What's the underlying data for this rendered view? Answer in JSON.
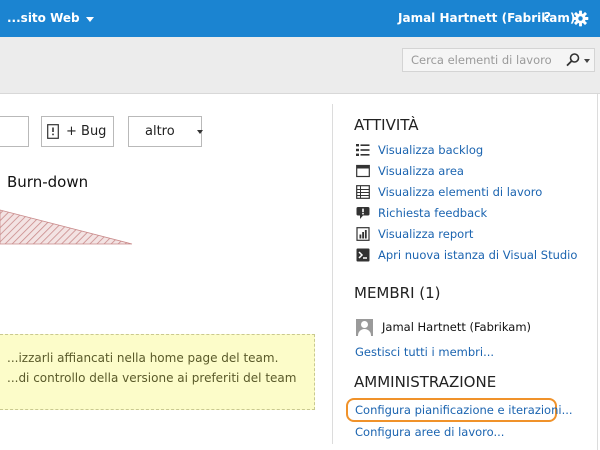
{
  "topbar": {
    "project_label": "...sito Web",
    "user_label": "Jamal Hartnett (Fabrikam)",
    "help_label": "?",
    "settings_icon": "gear-icon",
    "background": "#1b84d1"
  },
  "search": {
    "placeholder": "Cerca elementi di lavoro",
    "icon": "search-icon"
  },
  "toolbar": {
    "bug_label": "+ Bug",
    "more_label": "altro"
  },
  "main": {
    "chart_title": "Burn-down",
    "notice_lines": [
      "...izzarli affiancati nella home page del team.",
      "...di controllo della versione ai preferiti del team"
    ],
    "notice_background": "#fcfcc9"
  },
  "activity": {
    "heading": "ATTIVITÀ",
    "items": [
      {
        "label": "Visualizza backlog",
        "icon": "list-icon"
      },
      {
        "label": "Visualizza area",
        "icon": "window-icon"
      },
      {
        "label": "Visualizza elementi di lavoro",
        "icon": "grid-icon"
      },
      {
        "label": "Richiesta feedback",
        "icon": "feedback-icon"
      },
      {
        "label": "Visualizza report",
        "icon": "report-icon"
      },
      {
        "label": "Apri nuova istanza di Visual Studio",
        "icon": "visual-studio-icon"
      }
    ]
  },
  "members": {
    "heading": "MEMBRI (1)",
    "list": [
      {
        "name": "Jamal Hartnett (Fabrikam)"
      }
    ],
    "manage_link": "Gestisci tutti i membri..."
  },
  "admin": {
    "heading": "AMMINISTRAZIONE",
    "configure_iterations": "Configura pianificazione e iterazioni...",
    "configure_areas": "Configura aree di lavoro...",
    "highlight_color": "#f0922a"
  },
  "colors": {
    "link": "#1b64b0"
  }
}
